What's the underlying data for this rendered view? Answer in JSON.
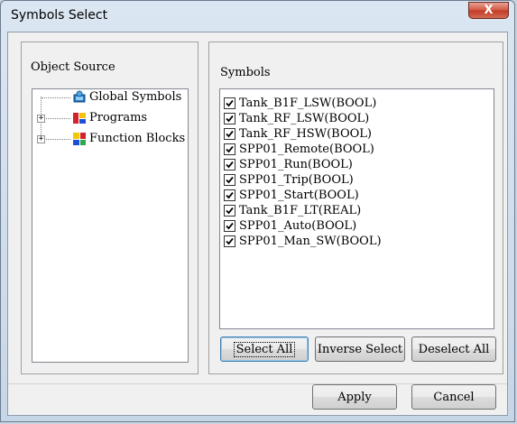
{
  "window": {
    "title": "Symbols Select",
    "close_glyph": "X"
  },
  "object_source": {
    "heading": "Object Source",
    "items": [
      {
        "label": "Global Symbols",
        "icon": "global-symbols-icon",
        "expandable": false
      },
      {
        "label": "Programs",
        "icon": "programs-icon",
        "expandable": true,
        "expander_glyph": "+"
      },
      {
        "label": "Function Blocks",
        "icon": "function-blocks-icon",
        "expandable": true,
        "expander_glyph": "+"
      }
    ]
  },
  "symbols": {
    "heading": "Symbols",
    "items": [
      {
        "label": "Tank_B1F_LSW(BOOL)",
        "checked": true
      },
      {
        "label": "Tank_RF_LSW(BOOL)",
        "checked": true
      },
      {
        "label": "Tank_RF_HSW(BOOL)",
        "checked": true
      },
      {
        "label": "SPP01_Remote(BOOL)",
        "checked": true
      },
      {
        "label": "SPP01_Run(BOOL)",
        "checked": true
      },
      {
        "label": "SPP01_Trip(BOOL)",
        "checked": true
      },
      {
        "label": "SPP01_Start(BOOL)",
        "checked": true
      },
      {
        "label": "Tank_B1F_LT(REAL)",
        "checked": true
      },
      {
        "label": "SPP01_Auto(BOOL)",
        "checked": true
      },
      {
        "label": "SPP01_Man_SW(BOOL)",
        "checked": true
      }
    ],
    "buttons": {
      "select_all": "Select All",
      "inverse_select": "Inverse Select",
      "deselect_all": "Deselect All"
    }
  },
  "footer": {
    "apply": "Apply",
    "cancel": "Cancel"
  },
  "colors": {
    "title_bar": "#dbe6f2",
    "close_button": "#c13a26",
    "dialog_face": "#f0f0f0"
  }
}
